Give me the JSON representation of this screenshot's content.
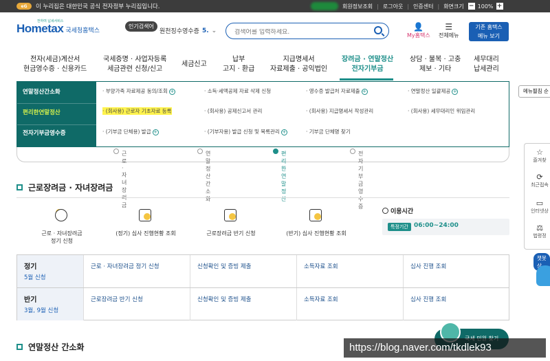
{
  "govbar": {
    "egov_label": "eG",
    "notice": "이 누리집은 대한민국 공식 전자정부 누리집입니다.",
    "links": [
      "회원정보조회",
      "로그아웃",
      "인증센터",
      "화면크기"
    ],
    "zoom": "100%",
    "zoom_minus": "−",
    "zoom_plus": "+"
  },
  "header": {
    "logo_main": "Hometax",
    "logo_sub": "국세청홈택스",
    "logo_tagline": "전하여 납세서비스",
    "popular_badge": "인기검색어",
    "popular_term": "원천징수영수증",
    "popular_rank": "5.",
    "search_placeholder": "검색어를 입력하세요.",
    "my_hometax": "My홈택스",
    "all_menu": "전체메뉴",
    "old_hometax_line1": "기존 홈택스",
    "old_hometax_line2": "메뉴 보기"
  },
  "gnb": [
    {
      "l1": "전자(세금)계산서",
      "l2": "현금영수증 · 신용카드",
      "active": false
    },
    {
      "l1": "국세증명 · 사업자등록",
      "l2": "세금관련 신청/신고",
      "active": false
    },
    {
      "l1": "세금신고",
      "l2": "",
      "active": false
    },
    {
      "l1": "납부",
      "l2": "고지 · 환급",
      "active": false
    },
    {
      "l1": "지급명세서",
      "l2": "자료제출 · 공익법인",
      "active": false
    },
    {
      "l1": "장려금 · 연말정산",
      "l2": "전자기부금",
      "active": true
    },
    {
      "l1": "상담 · 불복 · 고충",
      "l2": "제보 · 기타",
      "active": false
    },
    {
      "l1": "세무대리",
      "l2": "납세관리",
      "active": false
    }
  ],
  "mega": {
    "categories": [
      "연말정산간소화",
      "편리한연말정산",
      "전자기부금영수증"
    ],
    "rows": [
      [
        "· 부양가족 자료제공 동의/조회",
        "· 소득·세액공제 자료 삭제 신청",
        "· 영수증 발급처 자료제출",
        "· 연말정산 일괄제공"
      ],
      [
        "· (회사용) 근로자 기초자료 등록",
        "· (회사용) 공제신고서 관리",
        "· (회사용) 지급명세서 작성관리",
        "· (회사용) 세무대리인 위임관리"
      ],
      [
        "· (기부금 단체용) 발급",
        "· (기부자용) 발급 신청 및 목록관리",
        "· 기부금 단체명 찾기",
        ""
      ]
    ]
  },
  "side": {
    "menu_button": "메뉴펼침 순",
    "quick": [
      "즐겨찾",
      "최근접속",
      "인터넷상",
      "법령정"
    ],
    "chat_label": "챗봇 상"
  },
  "tabs": [
    "근로 · 자녀장려금",
    "연말정산 간소화",
    "편리한 연말정산",
    "전자기부금영수증"
  ],
  "section1": {
    "title": "근로장려금 · 자녀장려금",
    "services": [
      {
        "l1": "근로 · 자녀장려금",
        "l2": "정기 신청"
      },
      {
        "l1": "(정기) 심사 진행현황 조회",
        "l2": ""
      },
      {
        "l1": "근로장려금 반기 신청",
        "l2": ""
      },
      {
        "l1": "(반기) 심사 진행현황 조회",
        "l2": ""
      }
    ],
    "hours_title": "이용시간",
    "hours_tag": "특정기간",
    "hours_time": "06:00~24:00"
  },
  "schedule": [
    {
      "title": "정기",
      "period": "5월 신청",
      "cells": [
        "근로 · 자녀장려금 정기 신청",
        "신청확인 및 증빙 제출",
        "소득자료 조회",
        "심사 진행 조회"
      ]
    },
    {
      "title": "반기",
      "period": "3월, 9월 신청",
      "cells": [
        "근로장려금 반기 신청",
        "신청확인 및 증빙 제출",
        "소득자료 조회",
        "심사 진행 조회"
      ]
    }
  ],
  "section2": {
    "title": "연말정산 간소화"
  },
  "float_button": "국세 민원 찾기",
  "watermark": "https://blog.naver.com/tkdlek93",
  "colors": {
    "brand_blue": "#1a5fb4",
    "teal": "#0f6a67",
    "highlight": "#fff34d",
    "selected_category": "#d4f04c"
  }
}
